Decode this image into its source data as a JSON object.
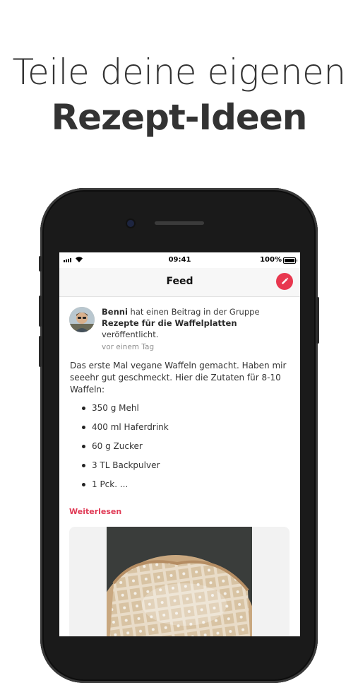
{
  "headline": {
    "line1": "Teile deine eigenen",
    "line2": "Rezept-Ideen"
  },
  "status_bar": {
    "time": "09:41",
    "battery": "100%"
  },
  "nav": {
    "title": "Feed",
    "compose_icon": "pencil-icon"
  },
  "post": {
    "author": "Benni",
    "action_text": "hat einen Beitrag in der Gruppe",
    "group": "Rezepte für die Waffelplatten",
    "published_text": "veröffentlicht.",
    "time_ago": "vor einem Tag",
    "body": "Das erste Mal vegane Waffeln gemacht. Haben mir seeehr gut geschmeckt. Hier die Zutaten für 8-10 Waffeln:",
    "ingredients": [
      "350 g Mehl",
      "400 ml Haferdrink",
      "60 g Zucker",
      "3 TL Backpulver",
      "1 Pck. ..."
    ],
    "read_more": "Weiterlesen"
  },
  "colors": {
    "accent": "#e8384f",
    "read_more": "#e03a55"
  }
}
